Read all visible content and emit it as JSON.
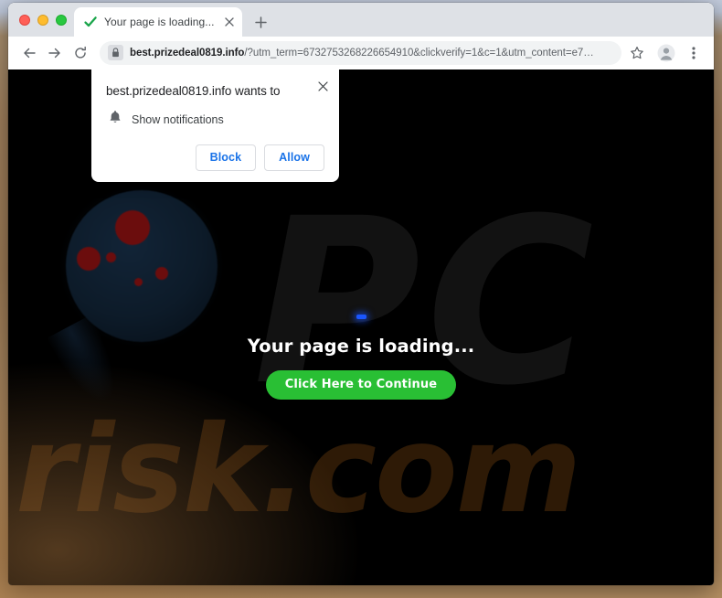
{
  "window": {
    "traffic_lights": [
      "close",
      "minimize",
      "zoom"
    ]
  },
  "tab": {
    "favicon": "green-check-icon",
    "title": "Your page is loading...",
    "close_label": "×",
    "newtab_label": "+"
  },
  "toolbar": {
    "back_icon": "back-arrow-icon",
    "forward_icon": "forward-arrow-icon",
    "reload_icon": "reload-icon",
    "lock_icon": "lock-icon",
    "url_domain": "best.prizedeal0819.info",
    "url_path": "/?utm_term=6732753268226654910&clickverify=1&c=1&utm_content=e7…",
    "star_icon": "bookmark-star-icon",
    "avatar_icon": "profile-avatar-icon",
    "menu_icon": "three-dot-menu-icon"
  },
  "permission_dialog": {
    "title": "best.prizedeal0819.info wants to",
    "bell_icon": "bell-icon",
    "permission_label": "Show notifications",
    "close_icon": "close-x-icon",
    "block_label": "Block",
    "allow_label": "Allow"
  },
  "page": {
    "watermark_primary": "PC",
    "watermark_secondary": "risk.com",
    "spinner": "loading-indicator",
    "headline": "Your page is loading...",
    "cta_label": "Click Here to Continue",
    "colors": {
      "background": "#000000",
      "cta_green": "#29bf34",
      "spinner_blue": "#1a56ff",
      "watermark_pc": "#121212",
      "watermark_risk": "#2e1a06"
    }
  }
}
